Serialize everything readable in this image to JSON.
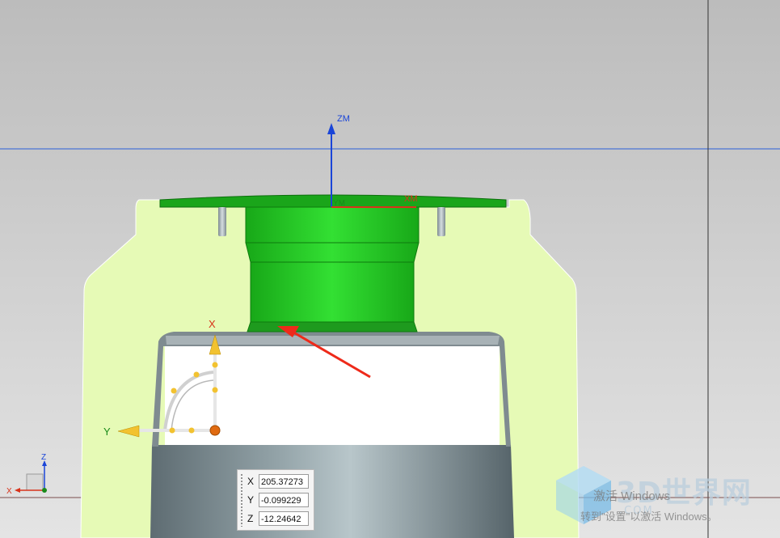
{
  "viewport": {
    "background_top": "#bfbfbf",
    "background_bottom": "#e3e3e3",
    "part_fill": "#e6fab6",
    "highlight_fill": "#1fb41f",
    "highlight_light": "#3ee83e",
    "datum_line_color": "#2b5fd9",
    "arrow_color": "#ee3322"
  },
  "wcs": {
    "z_label": "ZM",
    "x_label": "XM",
    "y_label": "YM"
  },
  "dynamic_handle": {
    "x_label": "X",
    "y_label": "Y"
  },
  "view_triad": {
    "z_label": "Z",
    "x_label": "X"
  },
  "coord_panel": {
    "x_label": "X",
    "x_value": "205.37273",
    "y_label": "Y",
    "y_value": "-0.099229",
    "z_label": "Z",
    "z_value": "-12.24642"
  },
  "watermark": {
    "brand": "3D世界网",
    "site": ".COM",
    "activate_title": "激活 Windows",
    "activate_sub": "转到\"设置\"以激活 Windows。"
  }
}
